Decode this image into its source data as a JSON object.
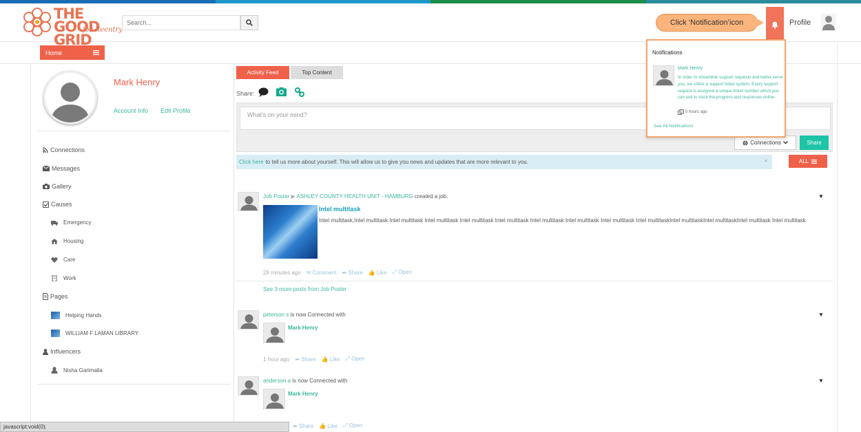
{
  "colors": {
    "accent": "#f0614a",
    "teal": "#3bb89b",
    "stripe": [
      "#1a6db5",
      "#1f98c9",
      "#1c8e4a",
      "#2b8a9c"
    ]
  },
  "logo": {
    "line1": "THE GOOD",
    "line2": "GRID",
    "sub": "for Reentry"
  },
  "search": {
    "placeholder": "Search..."
  },
  "callout": {
    "text": "Click ‘Notification’icon"
  },
  "header": {
    "profile_label": "Profile"
  },
  "subbar": {
    "home_label": "Home"
  },
  "profile": {
    "name": "Mark Henry",
    "account_info": "Account Info",
    "edit_profile": "Edit Profile"
  },
  "sidebar": {
    "connections": "Connections",
    "messages": "Messages",
    "gallery": "Gallery",
    "causes": "Causes",
    "cause_items": [
      "Emergency",
      "Housing",
      "Care",
      "Work"
    ],
    "pages": "Pages",
    "page_items": [
      "Helping Hands",
      "WILLIAM F LAMAN LIBRARY"
    ],
    "influencers": "Influencers",
    "influencer_items": [
      "Nisha Garimalla"
    ]
  },
  "feed": {
    "tabs": [
      "Activity Feed",
      "Top Content"
    ],
    "share_label": "Share:",
    "composer_placeholder": "What's on your mind?",
    "connections_label": "Connections",
    "share_button": "Share",
    "info_link": "Click here",
    "info_text": "to tell us more about yourself. This will allow us to give you news and updates that are more relevant to you.",
    "info_close": "×",
    "all_label": "ALL"
  },
  "posts": {
    "p1": {
      "author": "Job Poster",
      "target": "ASHLEY COUNTY HEALTH UNIT - HAMBURG",
      "action": "created a job.",
      "title": "Intel multitask",
      "body": "Intel multitask,Intel multitask Intel multitask Intel multitask Intel multitask Intel multitask Intel multitask Intel multitask Intel multitask  Intel multitaskIntel multitaskIntel multitaskIntel multitask Intel multitask",
      "time": "29 minutes ago",
      "comment": "Comment",
      "share": "Share",
      "like": "Like",
      "open": "Open",
      "more": "See 3 more posts from Job Poster"
    },
    "p2": {
      "author": "peterson s",
      "action": "is now Connected with",
      "target": "Mark Henry",
      "time": "1 hour ago",
      "share": "Share",
      "like": "Like",
      "open": "Open"
    },
    "p3": {
      "author": "anderson a",
      "action": "is now Connected with",
      "target": "Mark Henry",
      "share": "Share",
      "like": "Like",
      "open": "Open"
    }
  },
  "notifications": {
    "title": "Notifications",
    "item_name": "Mark Henry",
    "item_text": "In order to streamline support requests and better serve you, we utilize a support ticket system. Every support request is assigned a unique ticket number which you can use to track the progress and responses online.",
    "item_time": "5 hours ago",
    "see_all": "See All Notifications"
  },
  "statusbar": {
    "text": "javascript:void(0);"
  }
}
